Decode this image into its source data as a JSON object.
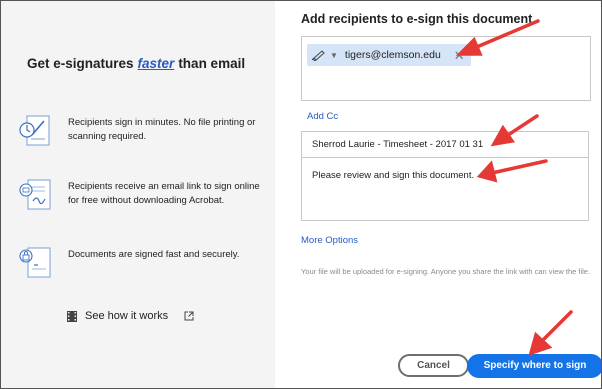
{
  "left_panel": {
    "headline_prefix": "Get e-signatures",
    "headline_emphasis": "faster",
    "headline_suffix": "than email",
    "features": [
      {
        "icon": "sign-document-icon",
        "text": "Recipients sign in minutes. No file printing or scanning required."
      },
      {
        "icon": "email-document-icon",
        "text": "Recipients receive an email link to sign online for free without downloading Acrobat."
      },
      {
        "icon": "secure-document-icon",
        "text": "Documents are signed fast and securely."
      }
    ],
    "how_link": "See how it works"
  },
  "form": {
    "title": "Add recipients to e-sign this document",
    "recipient_email": "tigers@clemson.edu",
    "add_cc": "Add Cc",
    "subject": "Sherrod Laurie - Timesheet - 2017 01 31",
    "message": "Please review and sign this document.",
    "more_options": "More Options",
    "note": "Your file will be uploaded for e-signing. Anyone you share the link with can view the file."
  },
  "buttons": {
    "cancel": "Cancel",
    "specify": "Specify where to sign"
  },
  "colors": {
    "accent": "#1473e6",
    "link": "#2b59c3",
    "chip": "#d6e4f8",
    "annotation_arrow": "#e53935"
  }
}
